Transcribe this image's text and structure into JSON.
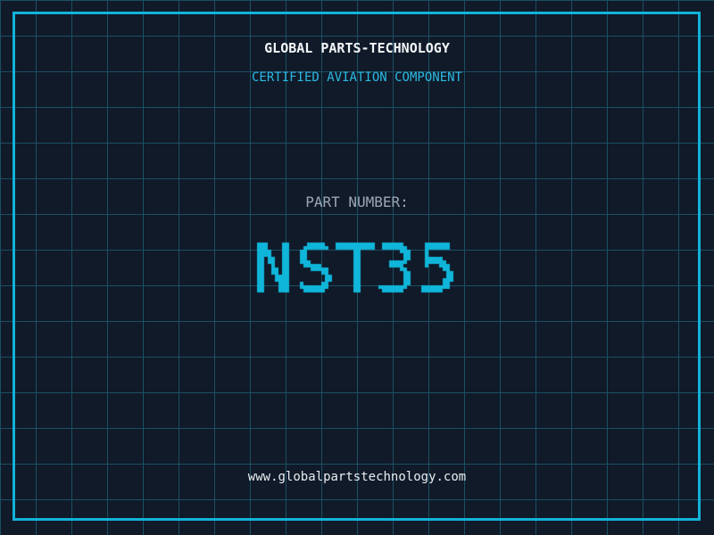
{
  "colors": {
    "background": "#101a29",
    "grid_line": "#1c4f63",
    "frame_border": "#12b2d8",
    "title_text": "#f4f6f8",
    "subtitle_text": "#2cb9e2",
    "label_text": "#9aa8b6",
    "part_number_text": "#10b6da",
    "url_text": "#e9edf0"
  },
  "header": {
    "title": "GLOBAL PARTS-TECHNOLOGY",
    "subtitle": "CERTIFIED AVIATION COMPONENT"
  },
  "part_number": {
    "label": "PART NUMBER:",
    "value": "NST35"
  },
  "footer": {
    "url": "www.globalpartstechnology.com"
  }
}
